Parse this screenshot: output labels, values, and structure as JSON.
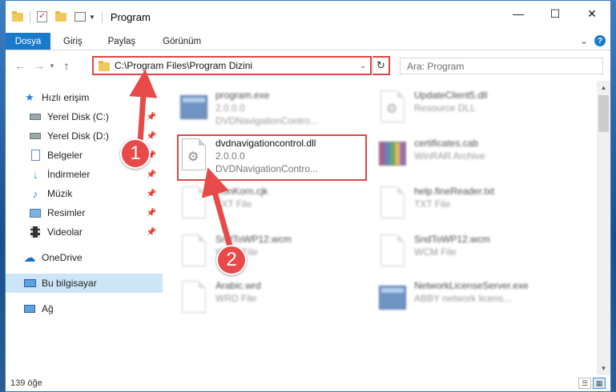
{
  "window": {
    "title": "Program",
    "controls": {
      "minimize": "—",
      "maximize": "☐",
      "close": "✕"
    }
  },
  "ribbon": {
    "tabs": [
      "Dosya",
      "Giriş",
      "Paylaş",
      "Görünüm"
    ],
    "help_label": "?",
    "expand_label": "⌄"
  },
  "address": {
    "path": "C:\\Program Files\\Program Dizini",
    "search_placeholder": "Ara: Program"
  },
  "sidebar": {
    "items": [
      {
        "label": "Hızlı erişim",
        "icon": "star-icon",
        "pinned": false
      },
      {
        "label": "Yerel Disk (C:)",
        "icon": "drive-icon",
        "pinned": true
      },
      {
        "label": "Yerel Disk (D:)",
        "icon": "drive-icon",
        "pinned": true
      },
      {
        "label": "Belgeler",
        "icon": "documents-icon",
        "pinned": true
      },
      {
        "label": "İndirmeler",
        "icon": "download-icon",
        "pinned": true
      },
      {
        "label": "Müzik",
        "icon": "music-icon",
        "pinned": true
      },
      {
        "label": "Resimler",
        "icon": "pictures-icon",
        "pinned": true
      },
      {
        "label": "Videolar",
        "icon": "videos-icon",
        "pinned": true
      },
      {
        "label": "OneDrive",
        "icon": "cloud-icon",
        "pinned": false
      },
      {
        "label": "Bu bilgisayar",
        "icon": "computer-icon",
        "pinned": false,
        "selected": true
      },
      {
        "label": "Ağ",
        "icon": "network-icon",
        "pinned": false
      }
    ]
  },
  "files": [
    {
      "name": "program.exe",
      "line2": "2.0.0.0",
      "line3": "DVDNavigationContro...",
      "kind": "exe",
      "blurred": true
    },
    {
      "name": "UpdateClient5.dll",
      "line2": "Resource DLL",
      "line3": "",
      "kind": "dll",
      "blurred": true
    },
    {
      "name": "dvdnavigationcontrol.dll",
      "line2": "2.0.0.0",
      "line3": "DVDNavigationContro...",
      "kind": "dll",
      "blurred": false,
      "highlighted": true
    },
    {
      "name": "certificates.cab",
      "line2": "WinRAR Archive",
      "line3": "",
      "kind": "rar",
      "blurred": true
    },
    {
      "name": "ConKorn.cjk",
      "line2": "TXT File",
      "line3": "",
      "kind": "doc",
      "blurred": true
    },
    {
      "name": "help.fineReader.txt",
      "line2": "TXT File",
      "line3": "",
      "kind": "doc",
      "blurred": true
    },
    {
      "name": "SndToWP12.wcm",
      "line2": "WCM File",
      "line3": "",
      "kind": "doc",
      "blurred": true
    },
    {
      "name": "SndToWP12.wcm",
      "line2": "WCM File",
      "line3": "",
      "kind": "doc",
      "blurred": true
    },
    {
      "name": "Arabic.wrd",
      "line2": "WRD File",
      "line3": "",
      "kind": "doc",
      "blurred": true
    },
    {
      "name": "NetworkLicenseServer.exe",
      "line2": "ABBY network licens...",
      "line3": "",
      "kind": "exeimg",
      "blurred": true
    }
  ],
  "status": {
    "item_count": "139 öğe"
  },
  "annotations": {
    "step1": "1",
    "step2": "2",
    "color": "#e84a4a"
  },
  "colors": {
    "accent": "#1979ca",
    "selection": "#cde6f7",
    "highlight": "#e04545"
  }
}
